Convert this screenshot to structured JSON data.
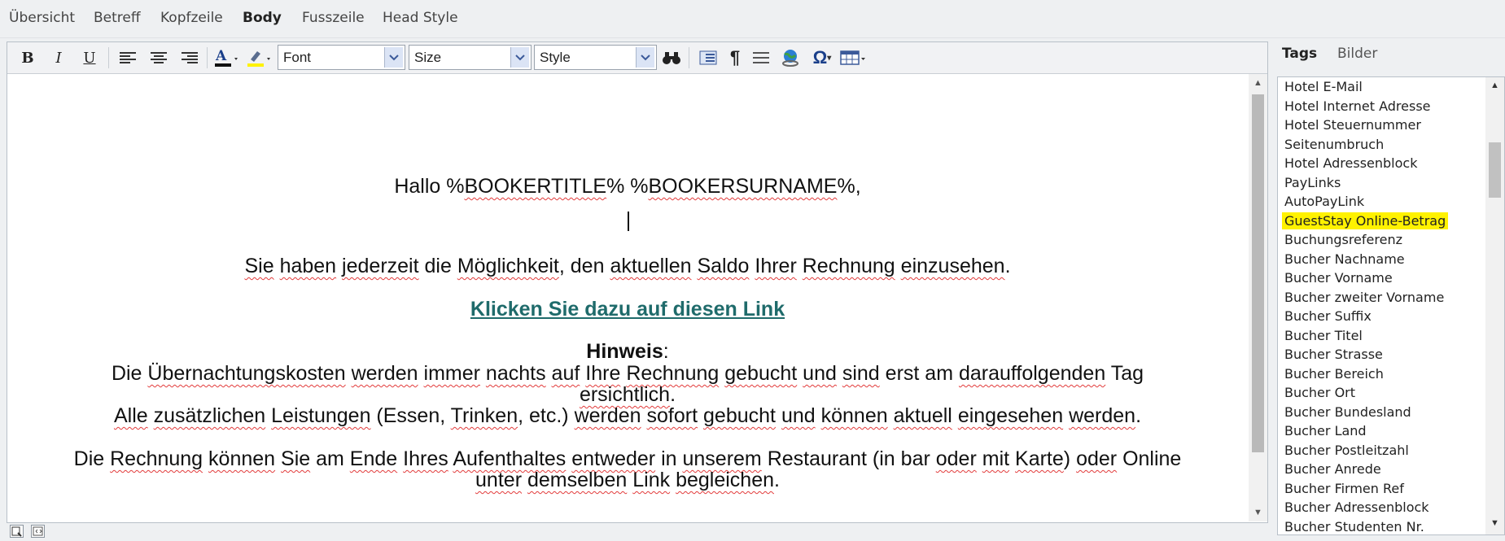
{
  "top_tabs": [
    {
      "label": "Übersicht",
      "active": false
    },
    {
      "label": "Betreff",
      "active": false
    },
    {
      "label": "Kopfzeile",
      "active": false
    },
    {
      "label": "Body",
      "active": true
    },
    {
      "label": "Fusszeile",
      "active": false
    },
    {
      "label": "Head Style",
      "active": false
    }
  ],
  "toolbar": {
    "bold": "B",
    "italic": "I",
    "underline": "U",
    "font_select": "Font",
    "size_select": "Size",
    "style_select": "Style"
  },
  "content": {
    "greeting": [
      "Hallo %",
      "BOOKERTITLE",
      "% %",
      "BOOKERSURNAME",
      "%,"
    ],
    "line1": [
      [
        "Sie",
        1
      ],
      " ",
      [
        "haben",
        1
      ],
      " ",
      [
        "jederzeit",
        1
      ],
      " die ",
      [
        "Möglichkeit",
        1
      ],
      ", den ",
      [
        "aktuellen",
        1
      ],
      " ",
      [
        "Saldo",
        1
      ],
      " ",
      [
        "Ihrer",
        1
      ],
      " ",
      [
        "Rechnung",
        1
      ],
      " ",
      [
        "einzusehen",
        1
      ],
      "."
    ],
    "link_text": "Klicken Sie dazu auf diesen Link",
    "hint_label": "Hinweis",
    "hint_colon": ":",
    "line2a": [
      "Die ",
      [
        "Übernachtungskosten",
        1
      ],
      " ",
      [
        "werden",
        1
      ],
      " ",
      [
        "immer",
        1
      ],
      " ",
      [
        "nachts",
        1
      ],
      " ",
      [
        "auf",
        1
      ],
      " ",
      [
        "Ihre",
        1
      ],
      " ",
      [
        "Rechnung",
        1
      ],
      " ",
      [
        "gebucht",
        1
      ],
      " ",
      [
        "und",
        1
      ],
      " ",
      [
        "sind",
        1
      ],
      " erst am ",
      [
        "darauffolgenden",
        1
      ],
      " Tag"
    ],
    "line2b": [
      [
        "ersichtlich",
        1
      ],
      "."
    ],
    "line3": [
      [
        "Alle",
        1
      ],
      " ",
      [
        "zusätzlichen",
        1
      ],
      " ",
      [
        "Leistungen",
        1
      ],
      " (Essen, ",
      [
        "Trinken",
        1
      ],
      ", etc.) ",
      [
        "werden",
        1
      ],
      " ",
      [
        "sofort",
        1
      ],
      " ",
      [
        "gebucht",
        1
      ],
      " ",
      [
        "und",
        1
      ],
      " ",
      [
        "können",
        1
      ],
      " ",
      [
        "aktuell",
        1
      ],
      " ",
      [
        "eingesehen",
        1
      ],
      " ",
      [
        "werden",
        1
      ],
      "."
    ],
    "line4": [
      "Die ",
      [
        "Rechnung",
        1
      ],
      " ",
      [
        "können",
        1
      ],
      " ",
      [
        "Sie",
        1
      ],
      " am ",
      [
        "Ende",
        1
      ],
      " ",
      [
        "Ihres",
        1
      ],
      " ",
      [
        "Aufenthaltes",
        1
      ],
      " ",
      [
        "entweder",
        1
      ],
      " in ",
      [
        "unserem",
        1
      ],
      " Restaurant (in bar ",
      [
        "oder",
        1
      ],
      " ",
      [
        "mit",
        1
      ],
      " ",
      [
        "Karte",
        1
      ],
      ") ",
      [
        "oder",
        1
      ],
      " Online"
    ],
    "line5": [
      [
        "unter",
        1
      ],
      " ",
      [
        "demselben",
        1
      ],
      " ",
      [
        "Link",
        1
      ],
      " ",
      [
        "begleichen",
        1
      ],
      "."
    ]
  },
  "side_tabs": [
    {
      "label": "Tags",
      "active": true
    },
    {
      "label": "Bilder",
      "active": false
    }
  ],
  "tags": [
    "Hotel E-Mail",
    "Hotel Internet Adresse",
    "Hotel Steuernummer",
    "Seitenumbruch",
    "Hotel Adressenblock",
    "PayLinks",
    "AutoPayLink",
    "GuestStay Online-Betrag",
    "Buchungsreferenz",
    "Bucher Nachname",
    "Bucher Vorname",
    "Bucher zweiter Vorname",
    "Bucher Suffix",
    "Bucher Titel",
    "Bucher Strasse",
    "Bucher Bereich",
    "Bucher Ort",
    "Bucher Bundesland",
    "Bucher Land",
    "Bucher Postleitzahl",
    "Bucher Anrede",
    "Bucher Firmen Ref",
    "Bucher Adressenblock",
    "Bucher Studenten Nr."
  ],
  "highlighted_tag": "GuestStay Online-Betrag",
  "colors": {
    "link": "#1f6b6b",
    "highlight": "#fff200",
    "spell_underline": "#e23b3b"
  }
}
